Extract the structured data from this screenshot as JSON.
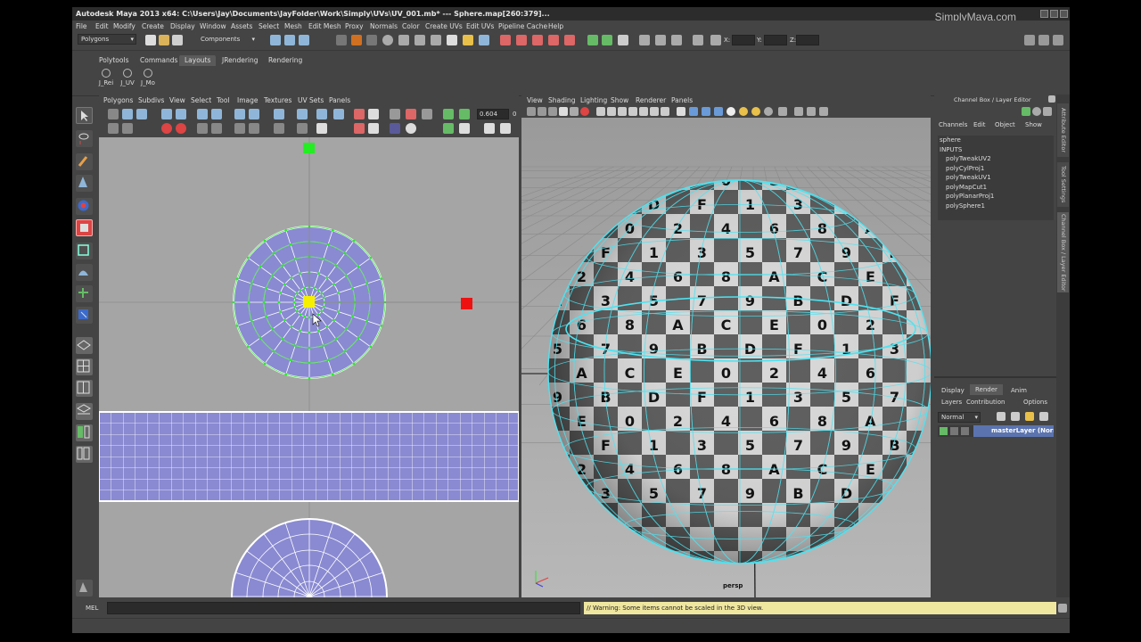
{
  "window": {
    "title": "Autodesk Maya 2013 x64: C:\\Users\\Jay\\Documents\\JayFolder\\Work\\Simply\\UVs\\UV_001.mb*   ---   Sphere.map[260:379]...",
    "brand": "SimplyMaya.com"
  },
  "menubar": [
    "File",
    "Edit",
    "Modify",
    "Create",
    "Display",
    "Window",
    "Assets",
    "Select",
    "Mesh",
    "Edit Mesh",
    "Proxy",
    "Normals",
    "Color",
    "Create UVs",
    "Edit UVs",
    "Pipeline Cache",
    "Help"
  ],
  "statusline": {
    "mode": "Polygons",
    "selection_mode": "Components",
    "x_label": "X:",
    "y_label": "Y:",
    "z_label": "Z:"
  },
  "shelf": {
    "tabs": [
      "Polytools",
      "Commands",
      "Layouts",
      "JRendering",
      "Rendering"
    ],
    "active_tab": "Layouts",
    "buttons": [
      "J_Rei",
      "J_UV",
      "J_Mo"
    ]
  },
  "uv_editor": {
    "menus": [
      "Polygons",
      "Subdivs",
      "View",
      "Select",
      "Tool",
      "Image",
      "Textures",
      "UV Sets",
      "Panels"
    ],
    "value": "0.604",
    "value2": "0"
  },
  "persp_panel": {
    "menus": [
      "View",
      "Shading",
      "Lighting",
      "Show",
      "Renderer",
      "Panels"
    ],
    "camera_label": "persp",
    "checker_rows": [
      "4567 89AB CDEF 0123",
      "89AB CDEF 0123 4567",
      "CDEF 0123 4567 89AB",
      "0123 4567 89AB CDEF"
    ]
  },
  "channel_box": {
    "header": "Channel Box / Layer Editor",
    "menus": [
      "Channels",
      "Edit",
      "Object",
      "Show"
    ],
    "object": "sphere",
    "inputs_label": "INPUTS",
    "inputs": [
      "polyTweakUV2",
      "polyCylProj1",
      "polyTweakUV1",
      "polyMapCut1",
      "polyPlanarProj1",
      "polySphere1"
    ]
  },
  "layer_editor": {
    "tabs": [
      "Display",
      "Render",
      "Anim"
    ],
    "active_tab": "Render",
    "menus": [
      "Layers",
      "Contribution",
      "Options"
    ],
    "blend_mode": "Normal",
    "layer_name": "masterLayer (Norm"
  },
  "side_tabs": [
    "Attribute Editor",
    "Tool Settings",
    "Channel Box / Layer Editor"
  ],
  "command_line": {
    "lang": "MEL",
    "value": "",
    "result": "// Warning: Some items cannot be scaled in the 3D view."
  },
  "colors": {
    "uv_shell": "#8a8ad2",
    "uv_bg": "#a5a5a5",
    "selection_green": "#22ee22",
    "pivot_yellow": "#f6f000",
    "wireframe_cyan": "#4fe3f0"
  }
}
